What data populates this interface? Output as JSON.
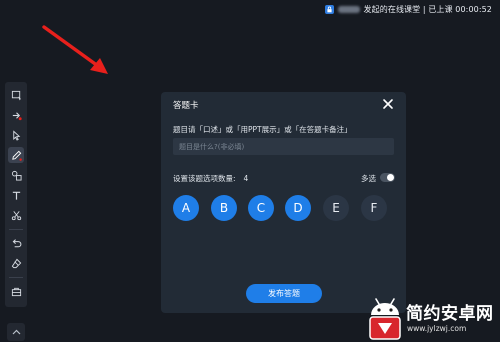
{
  "topbar": {
    "status": "发起的在线课堂 | 已上课 00:00:52",
    "lock_icon": "lock-icon"
  },
  "toolbar": {
    "tools": [
      {
        "name": "select-screen-icon"
      },
      {
        "name": "laser-pointer-icon"
      },
      {
        "name": "cursor-icon"
      },
      {
        "name": "pen-icon"
      },
      {
        "name": "shapes-icon"
      },
      {
        "name": "text-icon"
      },
      {
        "name": "scissors-icon"
      },
      {
        "name": "undo-icon"
      },
      {
        "name": "eraser-icon"
      },
      {
        "name": "toolbox-icon"
      }
    ],
    "active_tool": "pen-icon"
  },
  "dialog": {
    "title": "答题卡",
    "hint": "题目请「口述」或「用PPT展示」或「在答题卡备注」",
    "question_placeholder": "题目是什么?(非必填)",
    "option_count_label": "设置该题选项数量:",
    "option_count": "4",
    "multi_label": "多选",
    "multi_enabled": false,
    "options": [
      {
        "label": "A",
        "enabled": true
      },
      {
        "label": "B",
        "enabled": true
      },
      {
        "label": "C",
        "enabled": true
      },
      {
        "label": "D",
        "enabled": true
      },
      {
        "label": "E",
        "enabled": false
      },
      {
        "label": "F",
        "enabled": false
      }
    ],
    "publish_label": "发布答题"
  },
  "watermark": {
    "title": "简约安卓网",
    "url": "www.jylzwj.com"
  },
  "colors": {
    "background": "#161a21",
    "dialog": "#222b36",
    "accent": "#1f7ee8",
    "annotation": "#e8201c"
  }
}
